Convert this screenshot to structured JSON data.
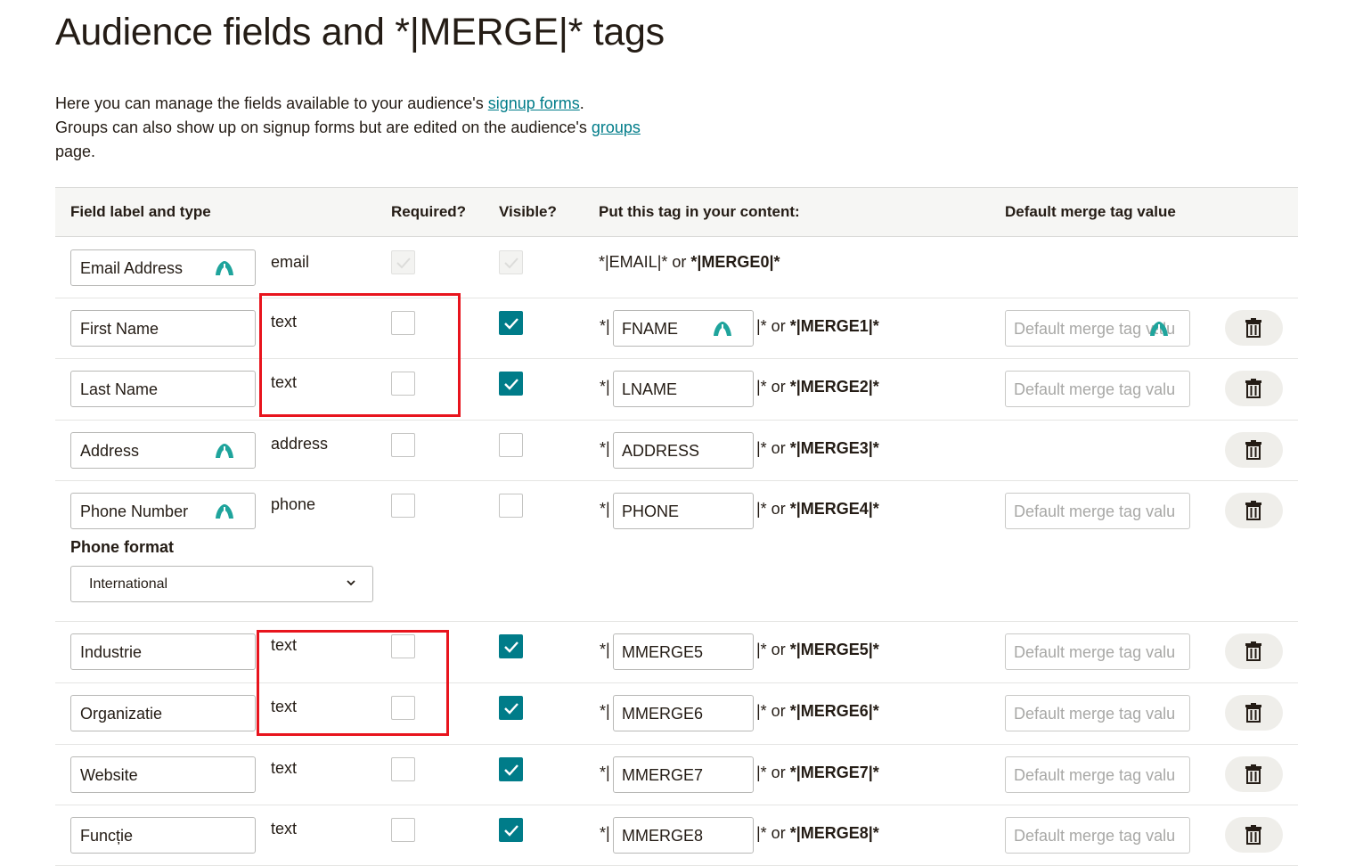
{
  "page": {
    "title": "Audience fields and *|MERGE|* tags",
    "intro_1": "Here you can manage the fields available to your audience's ",
    "intro_link_1": "signup forms",
    "intro_2": ".",
    "intro_3": "Groups can also show up on signup forms but are edited on the audience's ",
    "intro_link_2": "groups",
    "intro_4": "page."
  },
  "table": {
    "headers": {
      "label": "Field label and type",
      "required": "Required?",
      "visible": "Visible?",
      "tag": "Put this tag in your content:",
      "default": "Default merge tag value"
    },
    "default_placeholder": "Default merge tag valu",
    "tag_prefix": "*|",
    "or_text": "|* or ",
    "email_row": {
      "label": "Email Address",
      "type": "email",
      "tag_plain": "*|EMAIL|* or ",
      "tag_bold": "*|MERGE0|*"
    },
    "rows": [
      {
        "label": "First Name",
        "type": "text",
        "required": false,
        "visible": true,
        "tag": "FNAME",
        "merge": "*|MERGE1|*"
      },
      {
        "label": "Last Name",
        "type": "text",
        "required": false,
        "visible": true,
        "tag": "LNAME",
        "merge": "*|MERGE2|*"
      },
      {
        "label": "Address",
        "type": "address",
        "required": false,
        "visible": false,
        "tag": "ADDRESS",
        "merge": "*|MERGE3|*"
      },
      {
        "label": "Phone Number",
        "type": "phone",
        "required": false,
        "visible": false,
        "tag": "PHONE",
        "merge": "*|MERGE4|*"
      },
      {
        "label": "Industrie",
        "type": "text",
        "required": false,
        "visible": true,
        "tag": "MMERGE5",
        "merge": "*|MERGE5|*"
      },
      {
        "label": "Organizatie",
        "type": "text",
        "required": false,
        "visible": true,
        "tag": "MMERGE6",
        "merge": "*|MERGE6|*"
      },
      {
        "label": "Website",
        "type": "text",
        "required": false,
        "visible": true,
        "tag": "MMERGE7",
        "merge": "*|MERGE7|*"
      },
      {
        "label": "Funcție",
        "type": "text",
        "required": false,
        "visible": true,
        "tag": "MMERGE8",
        "merge": "*|MERGE8|*"
      }
    ],
    "phone_format": {
      "label": "Phone format",
      "selected": "International"
    }
  },
  "colors": {
    "accent": "#007c89",
    "highlight": "#e8141d"
  },
  "icons": {
    "field_icon": "mailchimp-freddie-icon",
    "delete": "trash-icon",
    "checkbox": "checkmark-icon",
    "select": "chevron-down-icon"
  }
}
